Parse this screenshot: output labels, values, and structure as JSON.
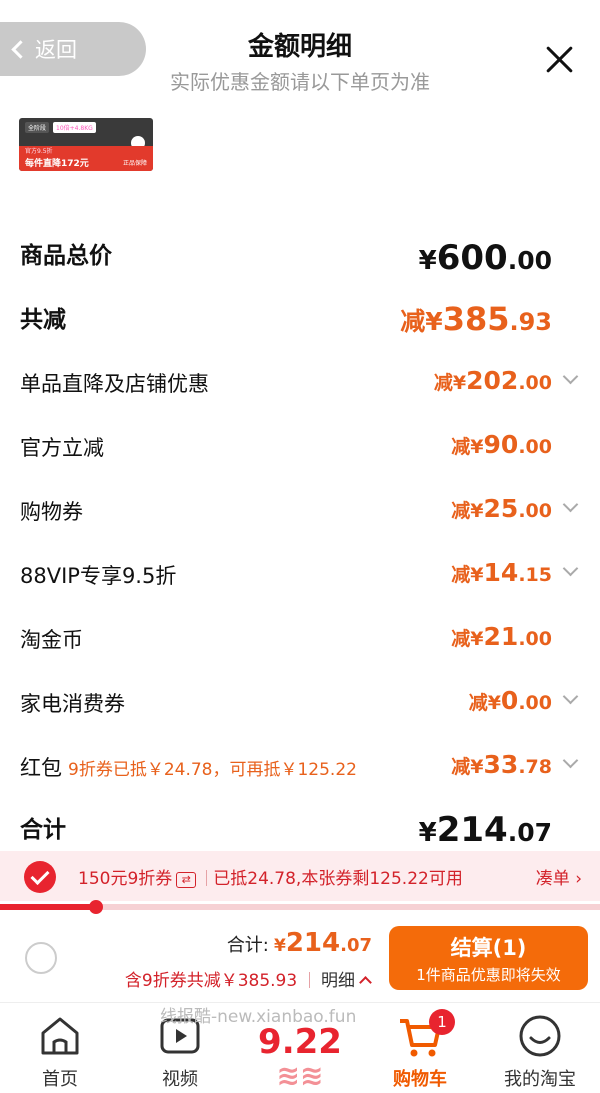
{
  "header": {
    "back_label": "返回",
    "title": "金额明细",
    "subtitle": "实际优惠金额请以下单页为准"
  },
  "thumb": {
    "tag1": "全阶段",
    "tag2": "10倍+4.8KG",
    "line1": "官方9.5折",
    "line2": "每件直降172元",
    "badge": "正品保障"
  },
  "rows": [
    {
      "label": "商品总价",
      "cur": "¥",
      "int": "600",
      "dec": ".00"
    },
    {
      "label": "共减",
      "cur": "减¥",
      "int": "385",
      "dec": ".93"
    },
    {
      "label": "单品直降及店铺优惠",
      "cur": "减¥",
      "int": "202",
      "dec": ".00"
    },
    {
      "label": "官方立减",
      "cur": "减¥",
      "int": "90",
      "dec": ".00"
    },
    {
      "label": "购物券",
      "cur": "减¥",
      "int": "25",
      "dec": ".00"
    },
    {
      "label": "88VIP专享9.5折",
      "cur": "减¥",
      "int": "14",
      "dec": ".15"
    },
    {
      "label": "淘金币",
      "cur": "减¥",
      "int": "21",
      "dec": ".00"
    },
    {
      "label": "家电消费券",
      "cur": "减¥",
      "int": "0",
      "dec": ".00"
    },
    {
      "label": "红包",
      "note": "9折券已抵￥24.78，可再抵￥125.22",
      "cur": "减¥",
      "int": "33",
      "dec": ".78"
    },
    {
      "label": "合计",
      "cur": "¥",
      "int": "214",
      "dec": ".07"
    }
  ],
  "coupon": {
    "name": "150元9折券",
    "swap": "⇄",
    "status": "已抵24.78,本张券剩125.22可用",
    "link": "凑单",
    "progress": 0.16
  },
  "checkout": {
    "sum_label": "合计:",
    "cur": "¥",
    "int": "214",
    "dec": ".07",
    "discount": "含9折券共减￥385.93",
    "detail": "明细",
    "pay_label": "结算(1)",
    "pay_sub": "1件商品优惠即将失效"
  },
  "tabs": [
    {
      "label": "首页",
      "icon": "home-icon"
    },
    {
      "label": "视频",
      "icon": "video-icon"
    },
    {
      "label": "购物车",
      "icon": "cart-icon",
      "badge": "1"
    },
    {
      "label": "我的淘宝",
      "icon": "profile-icon"
    }
  ],
  "promo_text": "9.22",
  "watermark": "线报酷-new.xianbao.fun",
  "colors": {
    "accent": "#e8611c",
    "red": "#e8242f",
    "pay": "#f46b0a"
  }
}
